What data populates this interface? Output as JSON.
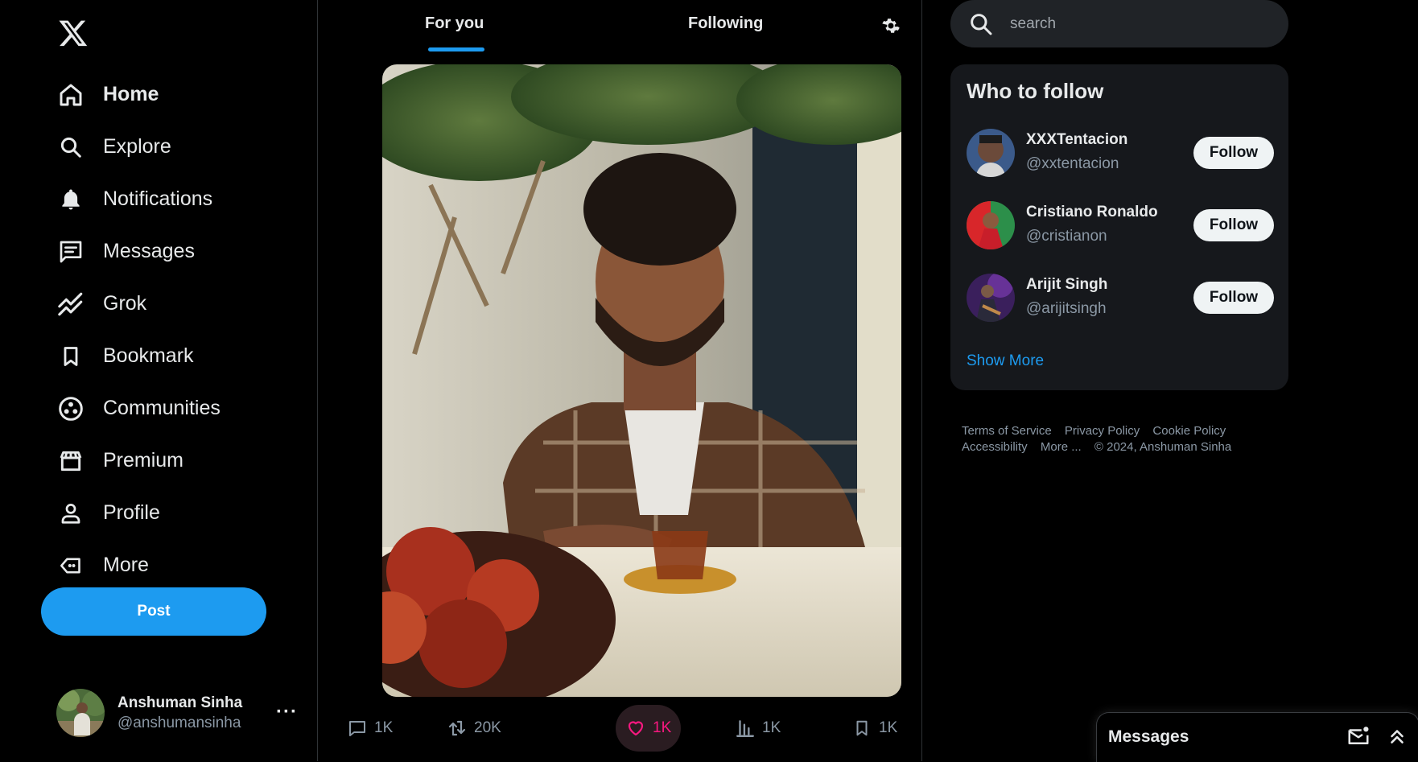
{
  "sidebar": {
    "logo_icon": "x-logo-icon",
    "items": [
      {
        "label": "Home",
        "icon": "home-icon",
        "active": true
      },
      {
        "label": "Explore",
        "icon": "search-icon"
      },
      {
        "label": "Notifications",
        "icon": "bell-icon"
      },
      {
        "label": "Messages",
        "icon": "message-icon"
      },
      {
        "label": "Grok",
        "icon": "grok-icon"
      },
      {
        "label": "Bookmark",
        "icon": "bookmark-icon"
      },
      {
        "label": "Communities",
        "icon": "communities-icon"
      },
      {
        "label": "Premium",
        "icon": "premium-icon"
      },
      {
        "label": "Profile",
        "icon": "person-icon"
      },
      {
        "label": "More",
        "icon": "more-icon"
      }
    ],
    "post_label": "Post",
    "account": {
      "name": "Anshuman Sinha",
      "handle": "@anshumansinha",
      "menu": "···"
    }
  },
  "feed": {
    "tabs": [
      {
        "label": "For you",
        "active": true
      },
      {
        "label": "Following"
      }
    ],
    "settings_icon": "gear-icon",
    "post": {
      "image_icon": "photo-image",
      "actions": [
        {
          "icon": "reply-icon",
          "count": "1K"
        },
        {
          "icon": "retweet-icon",
          "count": "20K"
        },
        {
          "icon": "heart-icon",
          "count": "1K",
          "liked": true
        },
        {
          "icon": "views-icon",
          "count": "1K"
        },
        {
          "icon": "bookmark-icon",
          "count": "1K"
        }
      ]
    }
  },
  "search": {
    "placeholder": "search",
    "icon": "search-icon"
  },
  "who_to_follow": {
    "title": "Who to follow",
    "users": [
      {
        "name": "XXXTentacion",
        "handle": "@xxtentacion",
        "button": "Follow"
      },
      {
        "name": "Cristiano Ronaldo",
        "handle": "@cristianon",
        "button": "Follow"
      },
      {
        "name": "Arijit Singh",
        "handle": "@arijitsingh",
        "button": "Follow"
      }
    ],
    "show_more": "Show More"
  },
  "footer": {
    "links": [
      "Terms of Service",
      "Privacy Policy",
      "Cookie Policy",
      "Accessibility",
      "More ..."
    ],
    "copyright": "© 2024, Anshuman Sinha"
  },
  "messages_drawer": {
    "title": "Messages",
    "compose_icon": "mail-compose-icon",
    "expand_icon": "chevrons-up-icon"
  },
  "colors": {
    "accent": "#1d9bf0",
    "like": "#f91880",
    "background": "#000000",
    "panel": "#16181c"
  }
}
